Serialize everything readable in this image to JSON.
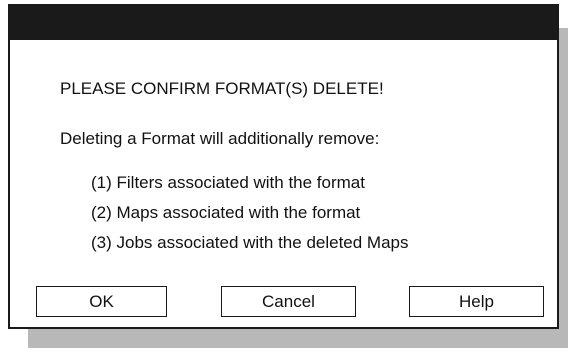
{
  "dialog": {
    "heading": "PLEASE CONFIRM FORMAT(S) DELETE!",
    "intro": "Deleting a Format will additionally remove:",
    "items": [
      "(1) Filters associated with the format",
      "(2) Maps associated with the format",
      "(3) Jobs associated with the deleted Maps"
    ],
    "buttons": {
      "ok": "OK",
      "cancel": "Cancel",
      "help": "Help"
    }
  },
  "colors": {
    "titlebar": "#1a1a1a",
    "shadow": "#b8b8b8",
    "background": "#ffffff"
  }
}
